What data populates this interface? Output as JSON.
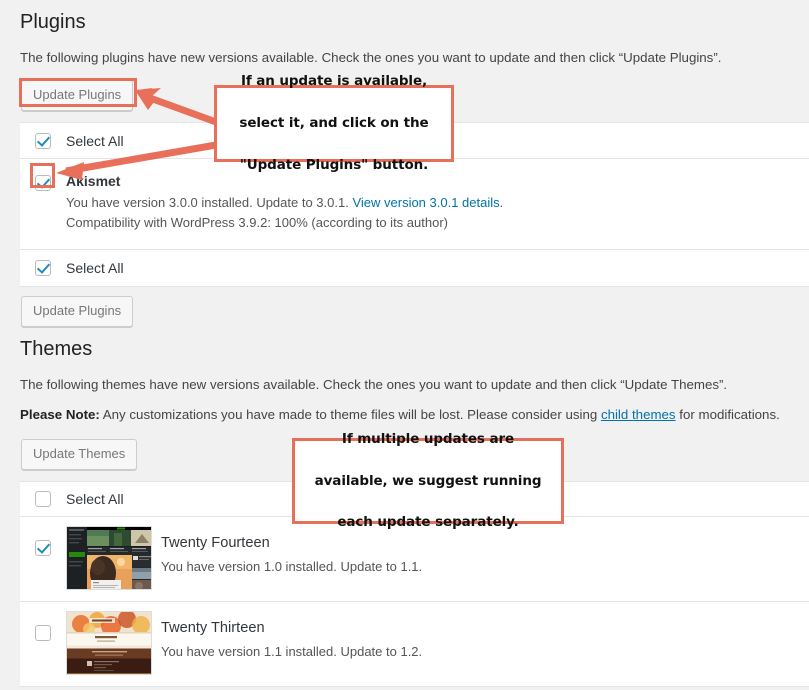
{
  "plugins": {
    "title": "Plugins",
    "description": "The following plugins have new versions available. Check the ones you want to update and then click “Update Plugins”.",
    "update_button_top": "Update Plugins",
    "update_button_bottom": "Update Plugins",
    "select_all_top": "Select All",
    "select_all_bottom": "Select All",
    "select_all_top_checked": true,
    "select_all_bottom_checked": true,
    "items": [
      {
        "name": "Akismet",
        "checked": true,
        "installed_text": "You have version 3.0.0 installed. Update to 3.0.1. ",
        "details_link": "View version 3.0.1 details",
        "details_suffix": ".",
        "compat_text": "Compatibility with WordPress 3.9.2: 100% (according to its author)"
      }
    ]
  },
  "themes": {
    "title": "Themes",
    "description": "The following themes have new versions available. Check the ones you want to update and then click “Update Themes”.",
    "note_label": "Please Note:",
    "note_text_before": " Any customizations you have made to theme files will be lost. Please consider using ",
    "note_link": "child themes",
    "note_text_after": " for modifications.",
    "update_button_top": "Update Themes",
    "select_all": "Select All",
    "select_all_checked": false,
    "items": [
      {
        "name": "Twenty Fourteen",
        "checked": true,
        "desc": "You have version 1.0 installed. Update to 1.1.",
        "thumb": "twentyfourteen-screenshot"
      },
      {
        "name": "Twenty Thirteen",
        "checked": false,
        "desc": "You have version 1.1 installed. Update to 1.2.",
        "thumb": "twentythirteen-screenshot"
      }
    ]
  },
  "annotations": {
    "callout1": "If an update is available, select it, and click on the \"Update Plugins\" button.",
    "callout1_lines": [
      "If an update is available,",
      "select it, and click on the",
      "\"Update Plugins\" button."
    ],
    "callout2_lines": [
      "If multiple updates are",
      "available, we suggest running",
      "each update separately."
    ],
    "accent_color": "#e8705a"
  },
  "colors": {
    "page_background": "#f1f1f1",
    "row_background": "#ffffff",
    "link": "#0073aa",
    "checkbox_check": "#1e8cbe",
    "accent": "#e8705a",
    "border": "#e5e5e5"
  }
}
